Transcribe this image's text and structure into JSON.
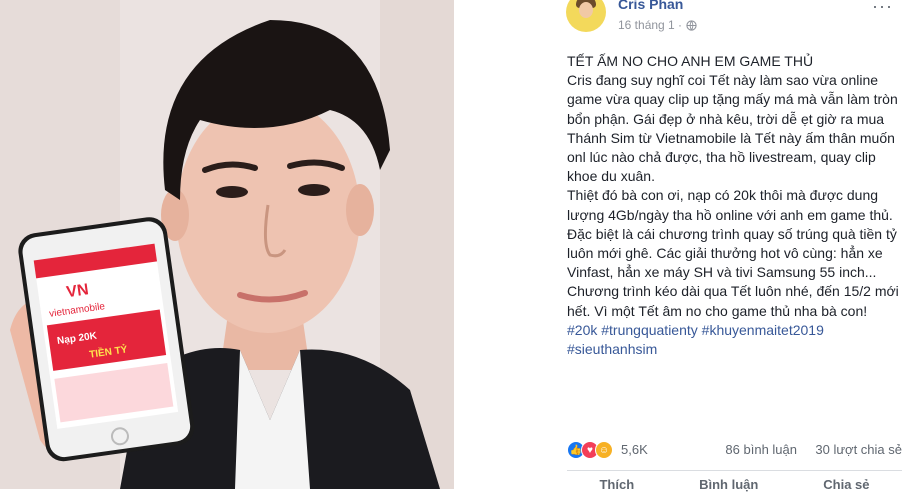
{
  "post": {
    "author": "Cris Phan",
    "date": "16 tháng 1 ·",
    "more": "···",
    "title": "TẾT ẤM NO CHO ANH EM GAME THỦ",
    "paragraph1": "Cris đang suy nghĩ coi Tết này làm sao vừa online game vừa quay clip up tặng mấy má mà vẫn làm tròn bổn phận. Gái đẹp ở nhà kêu, trời dễ ẹt giờ ra mua Thánh Sim từ Vietnamobile là Tết này ấm thân muốn onl lúc nào chả được, tha hồ livestream, quay clip khoe du xuân.",
    "paragraph2": "Thiệt đó bà con ơi, nạp có 20k thôi mà được dung lượng 4Gb/ngày tha hồ online với anh em game thủ. Đặc biệt là cái chương trình quay số trúng quà tiền tỷ luôn mới ghê. Các giải thưởng hot vô cùng: hẳn xe Vinfast, hẳn xe máy SH và tivi Samsung 55 inch... Chương trình kéo dài qua Tết luôn nhé, đến 15/2 mới hết. Vì một Tết âm no cho game thủ nha bà con!",
    "hashtags1": "#20k #trungquatienty #khuyenmaitet2019",
    "hashtags2": "#sieuthanhsim",
    "reactions": "5,6K",
    "comments": "86 bình luận",
    "shares": "30 lượt chia sẻ",
    "action_like": "Thích",
    "action_comment": "Bình luận",
    "action_share": "Chia sẻ"
  },
  "phone": {
    "brand": "vietnamobile",
    "promo": "Nạp 20K",
    "promo2": "TIỀN TỶ"
  },
  "colors": {
    "link": "#385898",
    "brand": "#e4253b"
  }
}
